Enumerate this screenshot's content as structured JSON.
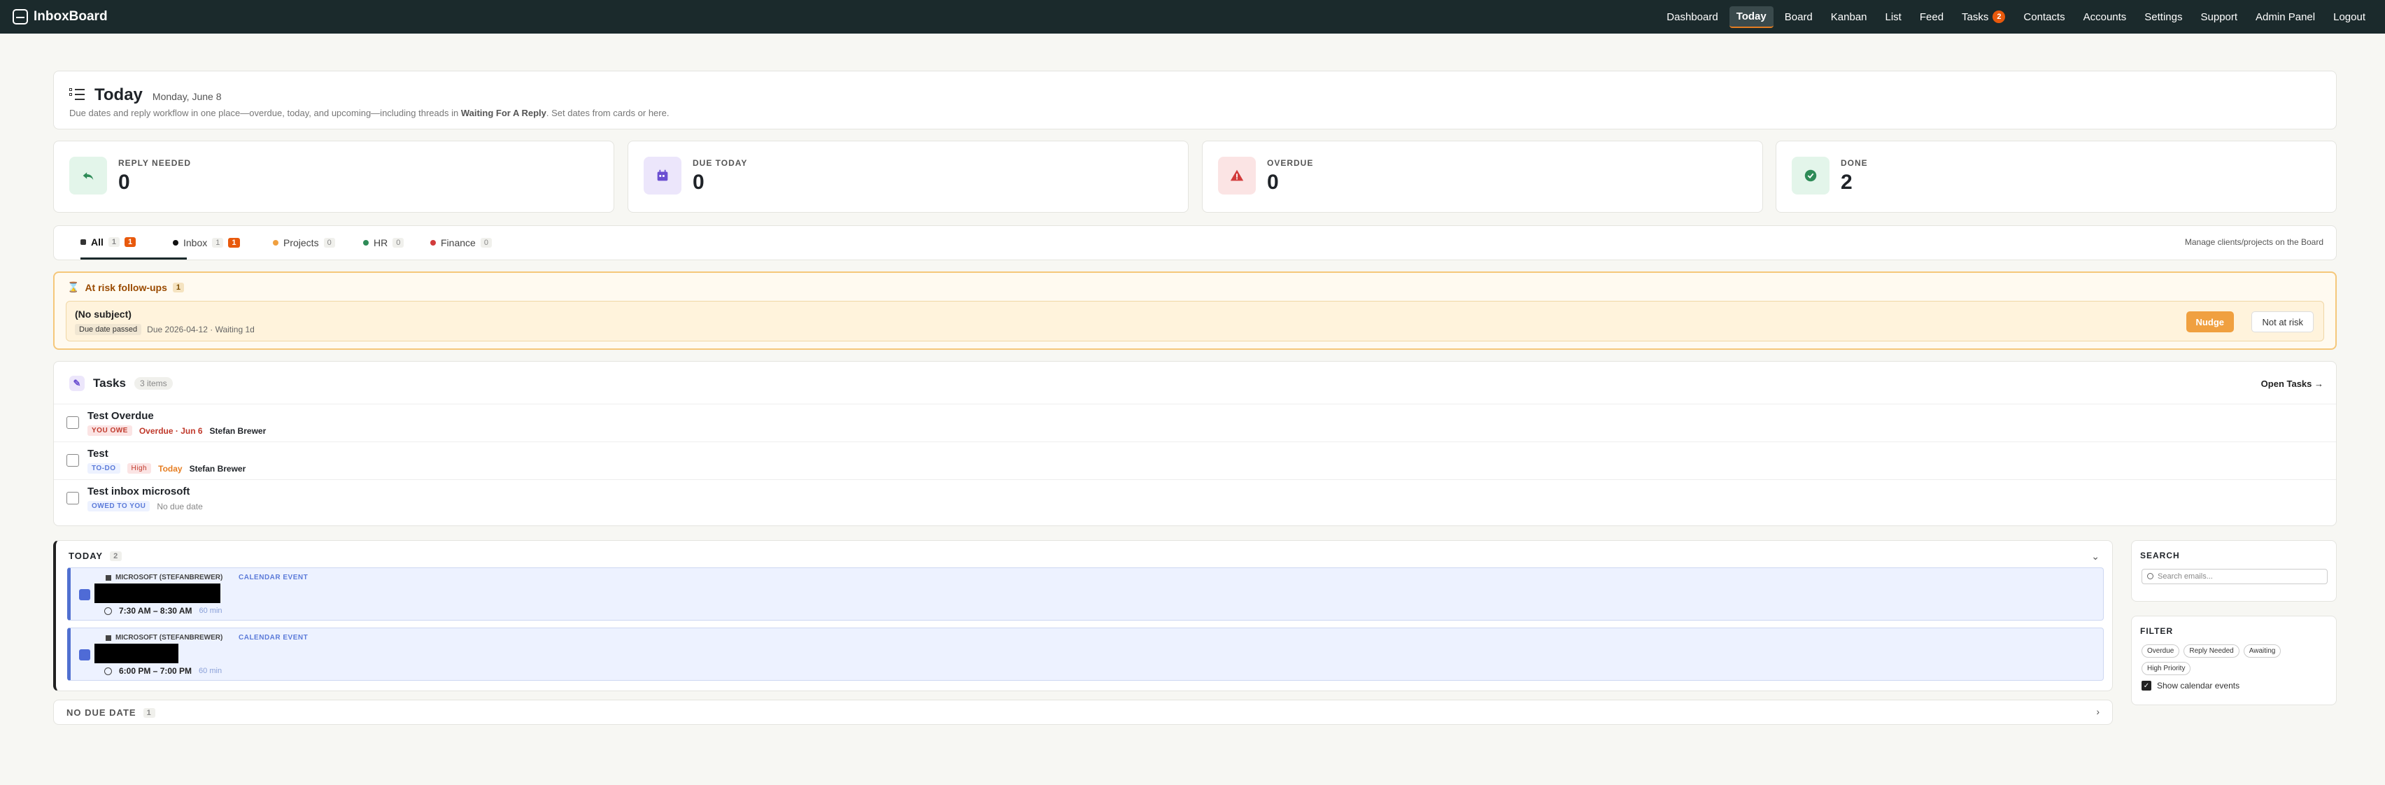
{
  "app": {
    "name": "InboxBoard"
  },
  "nav": {
    "items": [
      {
        "label": "Dashboard"
      },
      {
        "label": "Today",
        "active": true
      },
      {
        "label": "Board"
      },
      {
        "label": "Kanban"
      },
      {
        "label": "List"
      },
      {
        "label": "Feed"
      },
      {
        "label": "Tasks",
        "badge": "2"
      },
      {
        "label": "Contacts"
      },
      {
        "label": "Accounts"
      },
      {
        "label": "Settings"
      },
      {
        "label": "Support"
      },
      {
        "label": "Admin Panel"
      },
      {
        "label": "Logout"
      }
    ]
  },
  "header": {
    "title": "Today",
    "date": "Monday, June 8",
    "subtitle_pre": "Due dates and reply workflow in one place—overdue, today, and upcoming—including threads in ",
    "subtitle_bold": "Waiting For A Reply",
    "subtitle_post": ". Set dates from cards or here."
  },
  "stats": [
    {
      "label": "REPLY NEEDED",
      "value": "0",
      "icon": "reply-icon",
      "bg": "#e3f5ea",
      "fg": "#2e8b57"
    },
    {
      "label": "DUE TODAY",
      "value": "0",
      "icon": "calendar-icon",
      "bg": "#ece6fb",
      "fg": "#6b4fd1"
    },
    {
      "label": "OVERDUE",
      "value": "0",
      "icon": "warning-icon",
      "bg": "#fbe4e4",
      "fg": "#d23b3b"
    },
    {
      "label": "DONE",
      "value": "2",
      "icon": "check-circle-icon",
      "bg": "#e3f5ea",
      "fg": "#2e8b57"
    }
  ],
  "tabs": {
    "items": [
      {
        "label": "All",
        "count": "1",
        "alert": "1",
        "dot": "#333"
      },
      {
        "label": "Inbox",
        "count": "1",
        "alert": "1",
        "dot": "#111"
      },
      {
        "label": "Projects",
        "count": "0",
        "dot": "#f0a040"
      },
      {
        "label": "HR",
        "count": "0",
        "dot": "#2e8b57"
      },
      {
        "label": "Finance",
        "count": "0",
        "dot": "#d23b3b"
      }
    ],
    "manage_label": "Manage clients/projects on the Board"
  },
  "at_risk": {
    "title": "At risk follow-ups",
    "count": "1",
    "item": {
      "subject": "(No subject)",
      "badge": "Due date passed",
      "meta": "Due 2026-04-12 · Waiting 1d",
      "nudge": "Nudge",
      "not_at_risk": "Not at risk"
    }
  },
  "tasks": {
    "title": "Tasks",
    "items_label": "3 items",
    "open_label": "Open Tasks →",
    "items": [
      {
        "title": "Test Overdue",
        "tag": "YOU OWE",
        "tag_color": "#c0392b",
        "tag_bg": "#fbe4e4",
        "extra": "",
        "due": "Overdue · Jun 6",
        "due_color": "#c0392b",
        "person": "Stefan Brewer"
      },
      {
        "title": "Test",
        "tag": "TO-DO",
        "tag_color": "#5c7bd9",
        "tag_bg": "#edf2ff",
        "extra": "High",
        "due": "Today",
        "due_color": "#e67e22",
        "person": "Stefan Brewer"
      },
      {
        "title": "Test inbox microsoft",
        "tag": "OWED TO YOU",
        "tag_color": "#5c7bd9",
        "tag_bg": "#edf2ff",
        "extra": "",
        "due": "No due date",
        "due_color": "#888",
        "person": ""
      }
    ]
  },
  "today_panel": {
    "label": "TODAY",
    "count": "2",
    "events": [
      {
        "source": "MICROSOFT (STEFANBREWER)",
        "type": "CALENDAR EVENT",
        "time": "7:30 AM – 8:30 AM",
        "duration": "60 min"
      },
      {
        "source": "MICROSOFT (STEFANBREWER)",
        "type": "CALENDAR EVENT",
        "time": "6:00 PM – 7:00 PM",
        "duration": "60 min"
      }
    ]
  },
  "no_due": {
    "label": "NO DUE DATE",
    "count": "1"
  },
  "search": {
    "label": "SEARCH",
    "placeholder": "Search emails..."
  },
  "filter": {
    "label": "FILTER",
    "chips": [
      "Overdue",
      "Reply Needed",
      "Awaiting",
      "High Priority"
    ],
    "show_calendar": "Show calendar events"
  }
}
